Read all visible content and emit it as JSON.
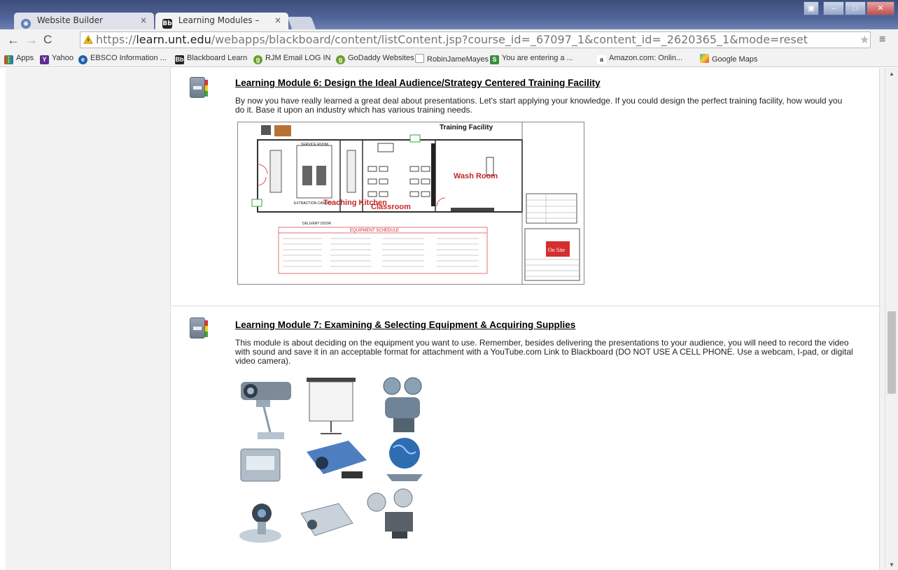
{
  "browser": {
    "tabs": [
      {
        "label": "Website Builder",
        "icon": "globe-icon",
        "active": false
      },
      {
        "label": "Learning Modules – LTEC",
        "icon": "blackboard-icon",
        "active": true
      }
    ],
    "address": {
      "scheme": "https://",
      "host": "learn.unt.edu",
      "path": "/webapps/blackboard/content/listContent.jsp?course_id=_67097_1&content_id=_2620365_1&mode=reset"
    },
    "bookmarks": [
      {
        "label": "Apps",
        "icon": "apps-grid-icon",
        "color": "#e33"
      },
      {
        "label": "Yahoo",
        "icon": "yahoo-icon",
        "color": "#5c2d91"
      },
      {
        "label": "EBSCO Information ...",
        "icon": "ebsco-icon",
        "color": "#1f5fa8"
      },
      {
        "label": "Blackboard Learn",
        "icon": "blackboard-icon",
        "color": "#222"
      },
      {
        "label": "RJM Email LOG IN",
        "icon": "godaddy-icon",
        "color": "#6a9f2b"
      },
      {
        "label": "GoDaddy Websites",
        "icon": "godaddy-icon",
        "color": "#6a9f2b"
      },
      {
        "label": "RobinJameMayes",
        "icon": "page-icon",
        "color": "#999"
      },
      {
        "label": "You are entering a ...",
        "icon": "website-s-icon",
        "color": "#3a8d3a"
      },
      {
        "label": "Amazon.com: Onlin...",
        "icon": "amazon-icon",
        "color": "#222"
      },
      {
        "label": "Google Maps",
        "icon": "maps-icon",
        "color": "#d44"
      }
    ]
  },
  "modules": [
    {
      "title": "Learning Module 6: Design the Ideal Audience/Strategy Centered Training Facility",
      "description": "By now you have really learned a great deal about presentations.  Let's start applying your knowledge.  If you could design the perfect training facility, how would you do it.  Base it upon an industry which has various training needs."
    },
    {
      "title": "Learning Module 7: Examining & Selecting Equipment & Acquiring Supplies",
      "description": "This module is about deciding on the equipment you want to use. Remember, besides delivering the presentations to your audience, you will need to record the video with sound and save it in an acceptable format for attachment with a YouTube.com Link to Blackboard (DO NOT USE A CELL PHONE.  Use a webcam, I-pad, or digital video camera)."
    }
  ],
  "floorplan": {
    "title": "Training Facility",
    "rooms": [
      "Teaching Kitchen",
      "Classroom",
      "Wash Room"
    ],
    "labels": [
      "SERVICE ROOM",
      "EXTRACTION CANOPY",
      "DELIVERY DOOR",
      "EQUIPMENT SCHEDULE"
    ],
    "logo_text": "On Site",
    "colors": {
      "room_label": "#c62828",
      "schedule_border": "#e57373"
    }
  }
}
